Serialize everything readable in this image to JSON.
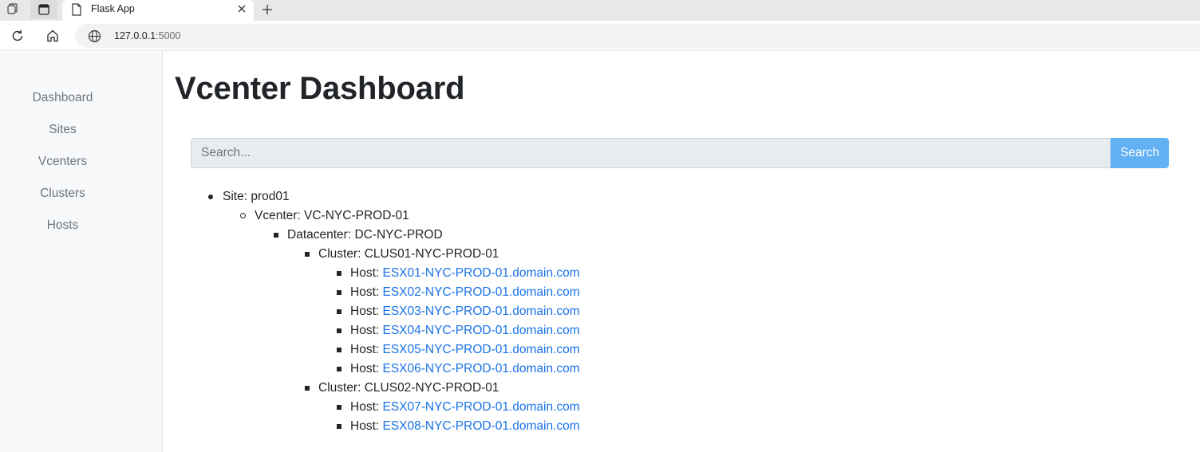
{
  "browser": {
    "tab_title": "Flask App",
    "url_host": "127.0.0.1",
    "url_port": ":5000"
  },
  "sidebar": {
    "items": [
      {
        "label": "Dashboard"
      },
      {
        "label": "Sites"
      },
      {
        "label": "Vcenters"
      },
      {
        "label": "Clusters"
      },
      {
        "label": "Hosts"
      }
    ]
  },
  "main": {
    "title": "Vcenter Dashboard",
    "search": {
      "placeholder": "Search...",
      "button_label": "Search"
    }
  },
  "tree": {
    "site": {
      "prefix": "Site: ",
      "name": "prod01"
    },
    "vcenter": {
      "prefix": "Vcenter: ",
      "name": "VC-NYC-PROD-01"
    },
    "datacenter": {
      "prefix": "Datacenter: ",
      "name": "DC-NYC-PROD"
    },
    "clusters": [
      {
        "prefix": "Cluster: ",
        "name": "CLUS01-NYC-PROD-01",
        "hosts": [
          {
            "prefix": "Host: ",
            "name": "ESX01-NYC-PROD-01.domain.com"
          },
          {
            "prefix": "Host: ",
            "name": "ESX02-NYC-PROD-01.domain.com"
          },
          {
            "prefix": "Host: ",
            "name": "ESX03-NYC-PROD-01.domain.com"
          },
          {
            "prefix": "Host: ",
            "name": "ESX04-NYC-PROD-01.domain.com"
          },
          {
            "prefix": "Host: ",
            "name": "ESX05-NYC-PROD-01.domain.com"
          },
          {
            "prefix": "Host: ",
            "name": "ESX06-NYC-PROD-01.domain.com"
          }
        ]
      },
      {
        "prefix": "Cluster: ",
        "name": "CLUS02-NYC-PROD-01",
        "hosts": [
          {
            "prefix": "Host: ",
            "name": "ESX07-NYC-PROD-01.domain.com"
          },
          {
            "prefix": "Host: ",
            "name": "ESX08-NYC-PROD-01.domain.com"
          }
        ]
      }
    ]
  },
  "colors": {
    "link": "#1a73e8",
    "search_button": "#61b1f4",
    "sidebar_bg": "#f8f9fa",
    "nav_text": "#6c757d"
  }
}
